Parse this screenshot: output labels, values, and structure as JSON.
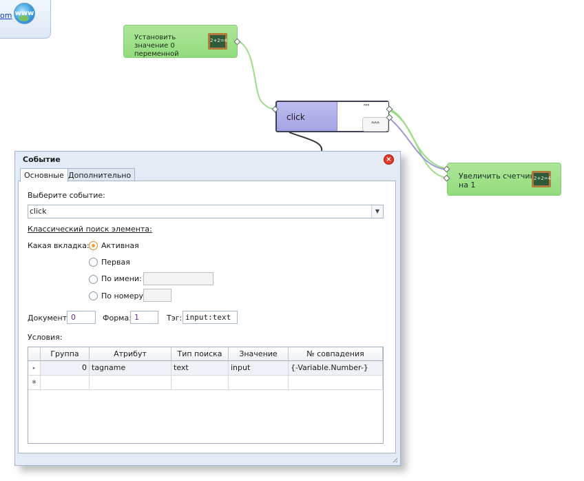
{
  "canvas": {
    "www_card": {
      "link_fragment": "om",
      "globe_label": "www"
    },
    "nodes": {
      "set_zero": {
        "text": "Установить значение 0 переменной",
        "board_icon": "chalkboard-icon"
      },
      "click_node": {
        "label": "click",
        "thumb_top": "ᐢᐢᐢ",
        "thumb_button": "ᐢᐢᐢ"
      },
      "increment": {
        "text": "Увеличить счетчик на 1",
        "board_icon": "chalkboard-icon"
      }
    },
    "board_text": "2+2=4"
  },
  "dialog": {
    "title": "Событие",
    "tabs": [
      {
        "label": "Основные",
        "active": true
      },
      {
        "label": "Дополнительно",
        "active": false
      }
    ],
    "choose_event_label": "Выберите событие:",
    "event_value": "click",
    "classic_search_label": "Классический поиск элемента:",
    "which_tab_label": "Какая вкладка:",
    "radios": [
      {
        "label": "Активная",
        "checked": true
      },
      {
        "label": "Первая",
        "checked": false
      },
      {
        "label": "По имени:",
        "checked": false,
        "input": ""
      },
      {
        "label": "По номеру:",
        "checked": false,
        "input": ""
      }
    ],
    "document_label": "Документ:",
    "document_value": "0",
    "form_label": "Форма:",
    "form_value": "1",
    "tag_label": "Тэг:",
    "tag_value": "input:text",
    "conditions_label": "Условия:",
    "grid": {
      "columns": [
        "Группа",
        "Атрибут",
        "Тип поиска",
        "Значение",
        "№ совпадения"
      ],
      "rows": [
        {
          "group": "0",
          "attribute": "tagname",
          "search_type": "text",
          "value": "input",
          "match": "{-Variable.Number-}"
        }
      ],
      "new_row_marker": "✱",
      "current_row_marker": "▸"
    }
  },
  "colors": {
    "green_node": "#9fe18a",
    "purple_node": "#aeabe8",
    "dialog_bg": "#e4ebf4",
    "radio_checked": "#e9a23c",
    "close": "#e03a2a"
  }
}
